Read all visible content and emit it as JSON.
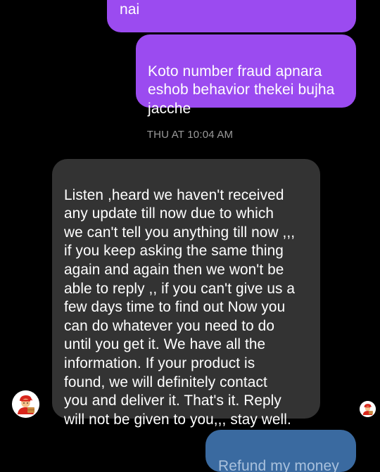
{
  "messages": [
    {
      "direction": "outgoing",
      "text": "pathaisen sheta porjonto bolen\nnai",
      "color": "#9b4bf0"
    },
    {
      "direction": "outgoing",
      "text": "Koto number fraud apnara\neshob behavior thekei bujha\njacche",
      "color": "#9b4bf0"
    },
    {
      "direction": "incoming",
      "text": "Listen ,heard we haven't received\nany update till now due to which\nwe can't tell you anything till now ,,,\nif you keep asking the same thing\nagain and again then we won't be\nable to reply ,, if you can't give us a\nfew days time to find out  Now you\ncan do whatever you need to do\nuntil you get it. We have all the\ninformation. If your product is\nfound, we will definitely contact\nyou and deliver it. That's it.  Reply\nwill not be given to you,,, stay well.",
      "color": "#333333"
    },
    {
      "direction": "outgoing",
      "text": "Refund my money",
      "color": "#3a6aa0"
    }
  ],
  "timestamp": "THU AT 10:04 AM",
  "avatars": {
    "sender_icon": "delivery-person-avatar-icon",
    "read_receipt_icon": "delivery-person-read-receipt-icon"
  }
}
